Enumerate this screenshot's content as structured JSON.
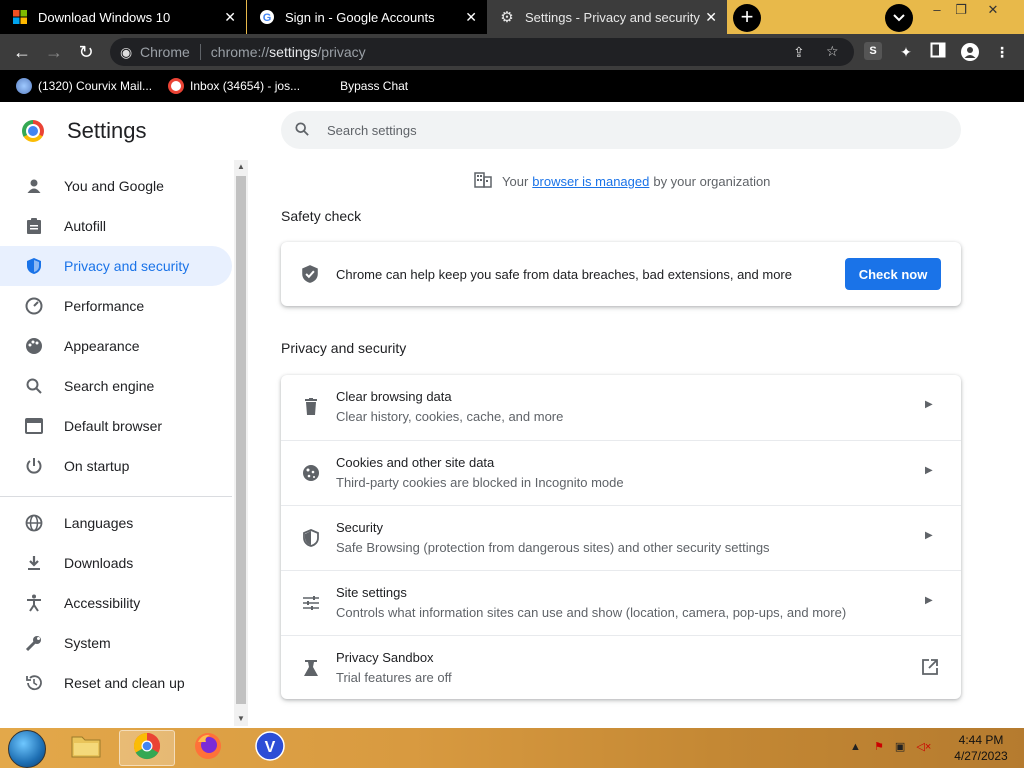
{
  "browser": {
    "tabs": [
      {
        "title": "Download Windows 10",
        "active": false
      },
      {
        "title": "Sign in - Google Accounts",
        "active": false
      },
      {
        "title": "Settings - Privacy and security",
        "active": true
      }
    ],
    "omnibox": {
      "chip": "Chrome",
      "url_prefix": "chrome://",
      "url_host": "settings",
      "url_path": "/privacy"
    },
    "bookmarks": [
      {
        "label": "(1320) Courvix Mail..."
      },
      {
        "label": "Inbox (34654) - jos..."
      },
      {
        "label": "Bypass Chat"
      }
    ]
  },
  "settings": {
    "title": "Settings",
    "search_placeholder": "Search settings",
    "managed": {
      "prefix": "Your",
      "link": "browser is managed",
      "suffix": "by your organization"
    },
    "nav": [
      {
        "label": "You and Google",
        "icon": "person-icon"
      },
      {
        "label": "Autofill",
        "icon": "clipboard-icon"
      },
      {
        "label": "Privacy and security",
        "icon": "shield-icon",
        "active": true
      },
      {
        "label": "Performance",
        "icon": "speedometer-icon"
      },
      {
        "label": "Appearance",
        "icon": "palette-icon"
      },
      {
        "label": "Search engine",
        "icon": "search-icon"
      },
      {
        "label": "Default browser",
        "icon": "browser-icon"
      },
      {
        "label": "On startup",
        "icon": "power-icon"
      },
      {
        "label": "Languages",
        "icon": "globe-icon"
      },
      {
        "label": "Downloads",
        "icon": "download-icon"
      },
      {
        "label": "Accessibility",
        "icon": "accessibility-icon"
      },
      {
        "label": "System",
        "icon": "wrench-icon"
      },
      {
        "label": "Reset and clean up",
        "icon": "restore-icon"
      }
    ],
    "safety_check": {
      "heading": "Safety check",
      "text": "Chrome can help keep you safe from data breaches, bad extensions, and more",
      "button": "Check now"
    },
    "privacy": {
      "heading": "Privacy and security",
      "rows": [
        {
          "title": "Clear browsing data",
          "subtitle": "Clear history, cookies, cache, and more",
          "icon": "trash-icon"
        },
        {
          "title": "Cookies and other site data",
          "subtitle": "Third-party cookies are blocked in Incognito mode",
          "icon": "cookie-icon"
        },
        {
          "title": "Security",
          "subtitle": "Safe Browsing (protection from dangerous sites) and other security settings",
          "icon": "shield-icon"
        },
        {
          "title": "Site settings",
          "subtitle": "Controls what information sites can use and show (location, camera, pop-ups, and more)",
          "icon": "sliders-icon"
        },
        {
          "title": "Privacy Sandbox",
          "subtitle": "Trial features are off",
          "icon": "flask-icon"
        }
      ]
    }
  },
  "taskbar": {
    "apps": [
      "file-explorer",
      "chrome",
      "firefox",
      "v-app"
    ],
    "time": "4:44 PM",
    "date": "4/27/2023"
  },
  "colors": {
    "accent": "#1a73e8",
    "active_nav_bg": "#e8f0fe",
    "tabstrip": "#e8b94a"
  }
}
